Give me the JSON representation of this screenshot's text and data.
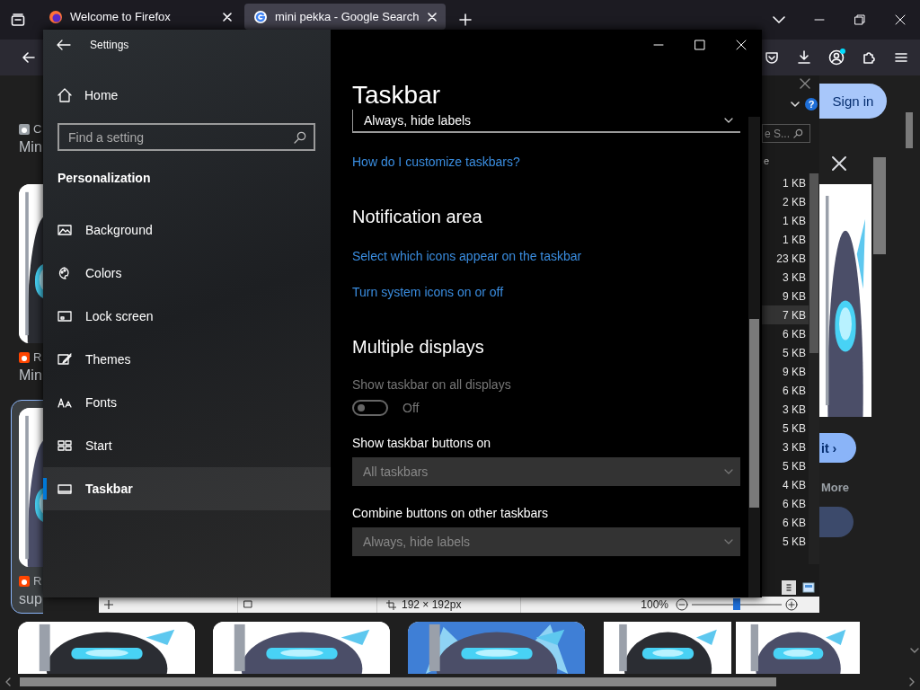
{
  "browser": {
    "tabs": [
      {
        "title": "Welcome to Firefox",
        "selected": false
      },
      {
        "title": "mini pekka - Google Search",
        "selected": true
      }
    ],
    "results": [
      {
        "source": "C",
        "title": "Min",
        "selected": false
      },
      {
        "source": "R",
        "title": "Min",
        "selected": false
      },
      {
        "source": "R",
        "title": "sup",
        "selected": true
      }
    ],
    "sign_in": "Sign in",
    "preview": {
      "visit": "it ›",
      "more": "More"
    }
  },
  "file_list": {
    "help": "?",
    "search_placeholder": "e S...",
    "header": "e",
    "rows": [
      {
        "size": "1 KB",
        "selected": false
      },
      {
        "size": "2 KB",
        "selected": false
      },
      {
        "size": "1 KB",
        "selected": false
      },
      {
        "size": "1 KB",
        "selected": false
      },
      {
        "size": "23 KB",
        "selected": false
      },
      {
        "size": "3 KB",
        "selected": false
      },
      {
        "size": "9 KB",
        "selected": false
      },
      {
        "size": "7 KB",
        "selected": true
      },
      {
        "size": "6 KB",
        "selected": false
      },
      {
        "size": "5 KB",
        "selected": false
      },
      {
        "size": "9 KB",
        "selected": false
      },
      {
        "size": "6 KB",
        "selected": false
      },
      {
        "size": "3 KB",
        "selected": false
      },
      {
        "size": "5 KB",
        "selected": false
      },
      {
        "size": "3 KB",
        "selected": false
      },
      {
        "size": "5 KB",
        "selected": false
      },
      {
        "size": "4 KB",
        "selected": false
      },
      {
        "size": "6 KB",
        "selected": false
      },
      {
        "size": "6 KB",
        "selected": false
      },
      {
        "size": "5 KB",
        "selected": false
      }
    ]
  },
  "image_viewer": {
    "dimensions": "192 × 192px",
    "zoom": "100%",
    "zoom_slider": {
      "level": 0.5
    }
  },
  "settings": {
    "title": "Settings",
    "home": "Home",
    "search_placeholder": "Find a setting",
    "section": "Personalization",
    "nav": [
      {
        "label": "Background",
        "selected": false
      },
      {
        "label": "Colors",
        "selected": false
      },
      {
        "label": "Lock screen",
        "selected": false
      },
      {
        "label": "Themes",
        "selected": false
      },
      {
        "label": "Fonts",
        "selected": false
      },
      {
        "label": "Start",
        "selected": false
      },
      {
        "label": "Taskbar",
        "selected": true
      }
    ],
    "page_title": "Taskbar",
    "content": [
      {
        "kind": "dropdown",
        "value": "Always, hide labels",
        "disabled": false
      },
      {
        "kind": "link",
        "text": "How do I customize taskbars?"
      },
      {
        "kind": "heading",
        "text": "Notification area"
      },
      {
        "kind": "link",
        "text": "Select which icons appear on the taskbar"
      },
      {
        "kind": "link",
        "text": "Turn system icons on or off"
      },
      {
        "kind": "heading",
        "text": "Multiple displays"
      },
      {
        "kind": "toggle",
        "label": "Show taskbar on all displays",
        "on": false,
        "state_text": "Off",
        "disabled": true
      },
      {
        "kind": "label",
        "text": "Show taskbar buttons on"
      },
      {
        "kind": "dropdown",
        "value": "All taskbars",
        "disabled": true
      },
      {
        "kind": "label",
        "text": "Combine buttons on other taskbars"
      },
      {
        "kind": "dropdown",
        "value": "Always, hide labels",
        "disabled": true
      }
    ]
  }
}
